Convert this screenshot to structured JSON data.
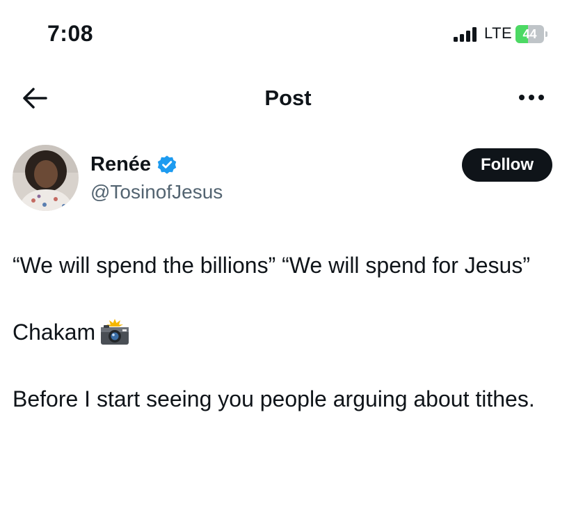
{
  "status_bar": {
    "time": "7:08",
    "network": "LTE",
    "battery": {
      "level": "44",
      "percent": 44,
      "charging": true,
      "color": "#4cd964"
    }
  },
  "header": {
    "title": "Post",
    "back_icon": "back-arrow-icon",
    "more_icon": "more-options-icon"
  },
  "author": {
    "name": "Renée",
    "handle": "@TosinofJesus",
    "verified": true,
    "verified_color": "#1d9bf0",
    "follow_label": "Follow"
  },
  "tweet": {
    "line1": "“We will spend the billions” “We will spend for Jesus”",
    "line2": "Chakam",
    "line2_emoji": "camera-with-flash-icon",
    "line3": "Before I start seeing you people arguing about tithes."
  }
}
